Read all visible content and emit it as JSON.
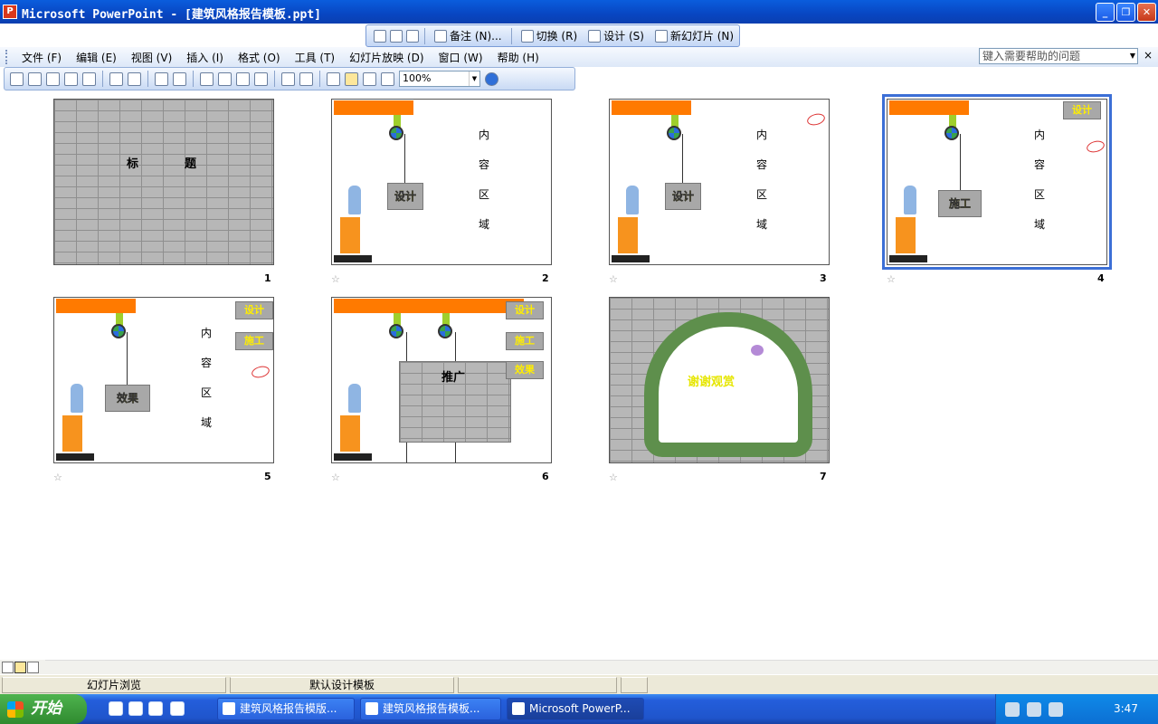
{
  "window": {
    "title": "Microsoft PowerPoint - [建筑风格报告模板.ppt]",
    "app_icon": "P"
  },
  "floatbar": {
    "items": [
      "备注 (N)...",
      "切换 (R)",
      "设计 (S)",
      "新幻灯片 (N)"
    ]
  },
  "menu": [
    "文件 (F)",
    "编辑 (E)",
    "视图 (V)",
    "插入 (I)",
    "格式 (O)",
    "工具 (T)",
    "幻灯片放映 (D)",
    "窗口 (W)",
    "帮助 (H)"
  ],
  "help": {
    "placeholder": "键入需要帮助的问题",
    "close": "×"
  },
  "toolbar": {
    "zoom": "100%"
  },
  "slides": [
    {
      "num": "1",
      "title_a": "标",
      "title_b": "题"
    },
    {
      "num": "2",
      "sign": "设计",
      "content": [
        "内",
        "容",
        "区",
        "域"
      ]
    },
    {
      "num": "3",
      "sign": "设计",
      "content": [
        "内",
        "容",
        "区",
        "域"
      ]
    },
    {
      "num": "4",
      "sign": "施工",
      "content": [
        "内",
        "容",
        "区",
        "域"
      ]
    },
    {
      "num": "5",
      "sign": "效果",
      "content": [
        "内",
        "容",
        "区",
        "域"
      ]
    },
    {
      "num": "6",
      "wall": "推广"
    },
    {
      "num": "7",
      "thanks": "谢谢观赏"
    }
  ],
  "mini_signs": [
    "设计",
    "施工",
    "效果"
  ],
  "status": {
    "view": "幻灯片浏览",
    "template": "默认设计模板"
  },
  "taskbar": {
    "start": "开始",
    "tasks": [
      "建筑风格报告模版...",
      "建筑风格报告模板...",
      "Microsoft PowerP..."
    ],
    "clock": "3:47"
  },
  "colors": {
    "accent": "#ff7a00",
    "title_bar": "#0846c2",
    "selection": "#3c6fd6"
  }
}
